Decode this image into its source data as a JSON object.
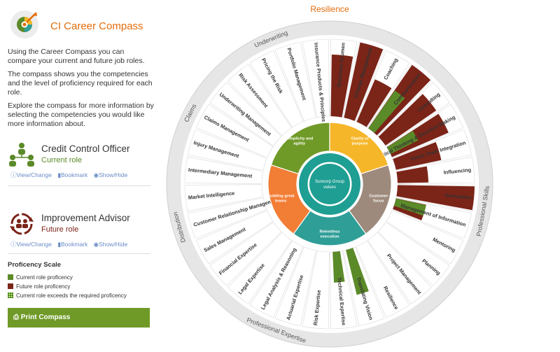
{
  "app": {
    "title": "CI Career Compass"
  },
  "intro": {
    "p1": "Using the Career Compass you can compare your current and future job roles.",
    "p2": "The compass shows you the competencies and the level of proficiency required for each role.",
    "p3": "Explore the compass for more information by selecting the competencies you would like more information about."
  },
  "current_role": {
    "name": "Credit Control Officer",
    "label": "Current role",
    "color": "#5b8a28",
    "actions": [
      "View/Change",
      "Bookmark",
      "Show/Hide"
    ]
  },
  "future_role": {
    "name": "Improvement Advisor",
    "label": "Future role",
    "color": "#7b2418",
    "actions": [
      "View/Change",
      "Bookmark",
      "Show/Hide"
    ]
  },
  "scale": {
    "title": "Proficency Scale",
    "items": [
      {
        "label": "Current role proficency",
        "color": "#5b8a28"
      },
      {
        "label": "Future role proficency",
        "color": "#7b2418"
      },
      {
        "label": "Current role exceeds the required proficency",
        "color": "#8ab84a"
      }
    ]
  },
  "print_button": "Print Compass",
  "compass": {
    "title": "Resilience",
    "center": "Suncorp Group values",
    "ring_text": "Simplicity and agility · Clarity of purpose · Customer focus · Relentless execution · Building great teams",
    "values": [
      {
        "label": "Simplicity and agility",
        "color": "#6f9a27"
      },
      {
        "label": "Clarity of purpose",
        "color": "#f6b62a"
      },
      {
        "label": "Customer focus",
        "color": "#9e8a7c"
      },
      {
        "label": "Relentless execution",
        "color": "#2f9e97"
      },
      {
        "label": "Building great teams",
        "color": "#f27d35"
      }
    ],
    "groups": [
      "Underwriting",
      "Claims",
      "Distribution",
      "Professional Expertise",
      "Professional Skills"
    ],
    "competencies": [
      {
        "label": "Business Acumen",
        "current": 0,
        "future": 4
      },
      {
        "label": "Change Management",
        "current": 0,
        "future": 5
      },
      {
        "label": "Coaching",
        "current": 0,
        "future": 3
      },
      {
        "label": "Communication",
        "current": 3,
        "future": 5
      },
      {
        "label": "Consulting",
        "current": 0,
        "future": 4
      },
      {
        "label": "Critical Thinking & Decision Making",
        "current": 2,
        "future": 4
      },
      {
        "label": "Cross Team Integration",
        "current": 0,
        "future": 3
      },
      {
        "label": "Influencing",
        "current": 0,
        "future": 2
      },
      {
        "label": "Innovation",
        "current": 0,
        "future": 5
      },
      {
        "label": "Management of Information",
        "current": 2,
        "future": 2
      },
      {
        "label": "Mentoring",
        "current": 0,
        "future": 0
      },
      {
        "label": "Planning",
        "current": 0,
        "future": 0
      },
      {
        "label": "Project Management",
        "current": 0,
        "future": 0
      },
      {
        "label": "Resilience",
        "current": 0,
        "future": 0
      },
      {
        "label": "Translating Vision",
        "current": 3,
        "future": 0
      },
      {
        "label": "Technical Expertise",
        "current": 2,
        "future": 0
      },
      {
        "label": "Risk Expertise",
        "current": 0,
        "future": 0
      },
      {
        "label": "Actuarial Expertise",
        "current": 0,
        "future": 0
      },
      {
        "label": "Legal Analysis & Reasoning",
        "current": 0,
        "future": 0
      },
      {
        "label": "Legal Expertise",
        "current": 0,
        "future": 0
      },
      {
        "label": "Financial Expertise",
        "current": 0,
        "future": 0
      },
      {
        "label": "Sales Management",
        "current": 0,
        "future": 0
      },
      {
        "label": "Customer Relationship Management",
        "current": 0,
        "future": 0
      },
      {
        "label": "Market Intelligence",
        "current": 0,
        "future": 0
      },
      {
        "label": "Intermediary Management",
        "current": 0,
        "future": 0
      },
      {
        "label": "Injury Management",
        "current": 0,
        "future": 0
      },
      {
        "label": "Claims Management",
        "current": 0,
        "future": 0
      },
      {
        "label": "Underwriting Management",
        "current": 0,
        "future": 0
      },
      {
        "label": "Risk Assessment",
        "current": 0,
        "future": 0
      },
      {
        "label": "Pricing the Risk",
        "current": 0,
        "future": 0
      },
      {
        "label": "Portfolio Management",
        "current": 0,
        "future": 0
      },
      {
        "label": "Insurance Products & Principles",
        "current": 0,
        "future": 0
      }
    ]
  }
}
